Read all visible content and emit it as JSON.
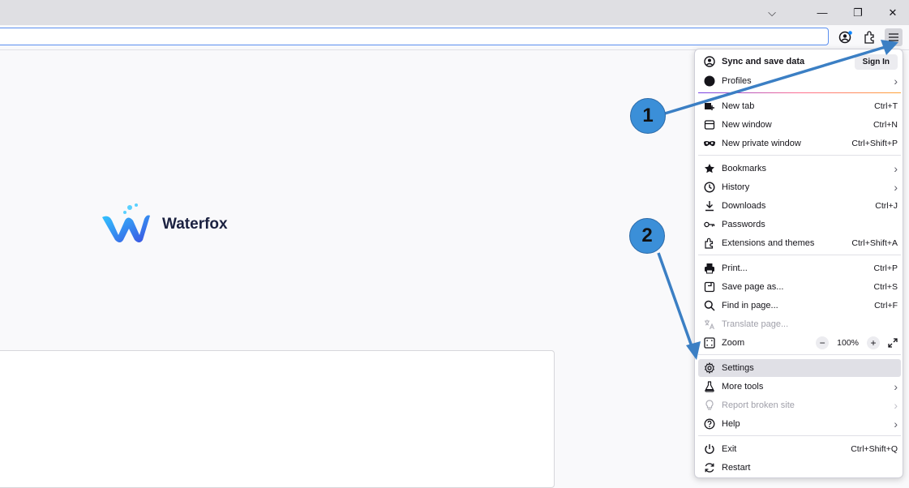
{
  "window": {
    "controls": [
      "⌵",
      "—",
      "❐",
      "✕"
    ]
  },
  "brand": {
    "name": "Waterfox"
  },
  "menu": {
    "sync": {
      "label": "Sync and save data",
      "button": "Sign In"
    },
    "profiles": {
      "label": "Profiles"
    },
    "new_tab": {
      "label": "New tab",
      "shortcut": "Ctrl+T"
    },
    "new_window": {
      "label": "New window",
      "shortcut": "Ctrl+N"
    },
    "new_private": {
      "label": "New private window",
      "shortcut": "Ctrl+Shift+P"
    },
    "bookmarks": {
      "label": "Bookmarks"
    },
    "history": {
      "label": "History"
    },
    "downloads": {
      "label": "Downloads",
      "shortcut": "Ctrl+J"
    },
    "passwords": {
      "label": "Passwords"
    },
    "extensions": {
      "label": "Extensions and themes",
      "shortcut": "Ctrl+Shift+A"
    },
    "print": {
      "label": "Print...",
      "shortcut": "Ctrl+P"
    },
    "save_page": {
      "label": "Save page as...",
      "shortcut": "Ctrl+S"
    },
    "find": {
      "label": "Find in page...",
      "shortcut": "Ctrl+F"
    },
    "translate": {
      "label": "Translate page..."
    },
    "zoom": {
      "label": "Zoom",
      "value": "100%",
      "minus": "−",
      "plus": "+"
    },
    "settings": {
      "label": "Settings"
    },
    "more_tools": {
      "label": "More tools"
    },
    "report": {
      "label": "Report broken site"
    },
    "help": {
      "label": "Help"
    },
    "exit": {
      "label": "Exit",
      "shortcut": "Ctrl+Shift+Q"
    },
    "restart": {
      "label": "Restart"
    }
  },
  "annotations": {
    "step1": "1",
    "step2": "2",
    "arrow_color": "#3b7fc4"
  }
}
